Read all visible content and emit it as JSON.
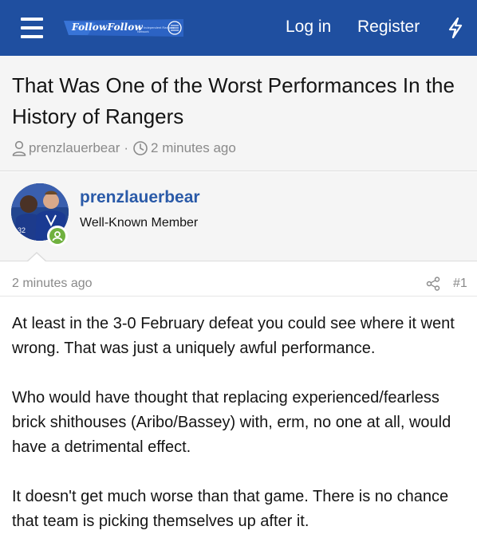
{
  "header": {
    "logo_text": "FollowFollow",
    "logo_tagline": "The Independent Rangers Network",
    "login_label": "Log in",
    "register_label": "Register",
    "bg_color": "#1f4fa0"
  },
  "thread": {
    "title": "That Was One of the Worst Performances In the History of Rangers",
    "author": "prenzlauerbear",
    "time": "2 minutes ago"
  },
  "post": {
    "author_name": "prenzlauerbear",
    "author_role": "Well-Known Member",
    "time": "2 minutes ago",
    "number": "#1",
    "paragraphs": [
      "At least in the 3-0 February defeat you could see where it went wrong. That was just a uniquely awful performance.",
      "Who would have thought that replacing experienced/fearless brick shithouses (Aribo/Bassey) with, erm, no one at all, would have a detrimental effect.",
      "It doesn't get much worse than that game. There is no chance that team is picking themselves up after it."
    ]
  },
  "icons": {
    "menu": "hamburger-icon",
    "whats_new": "bolt-icon",
    "user": "user-icon",
    "clock": "clock-icon",
    "share": "share-icon",
    "online": "online-status-icon"
  },
  "colors": {
    "link": "#2a5aa8",
    "muted": "#8a8a8a",
    "online": "#70b13f"
  }
}
